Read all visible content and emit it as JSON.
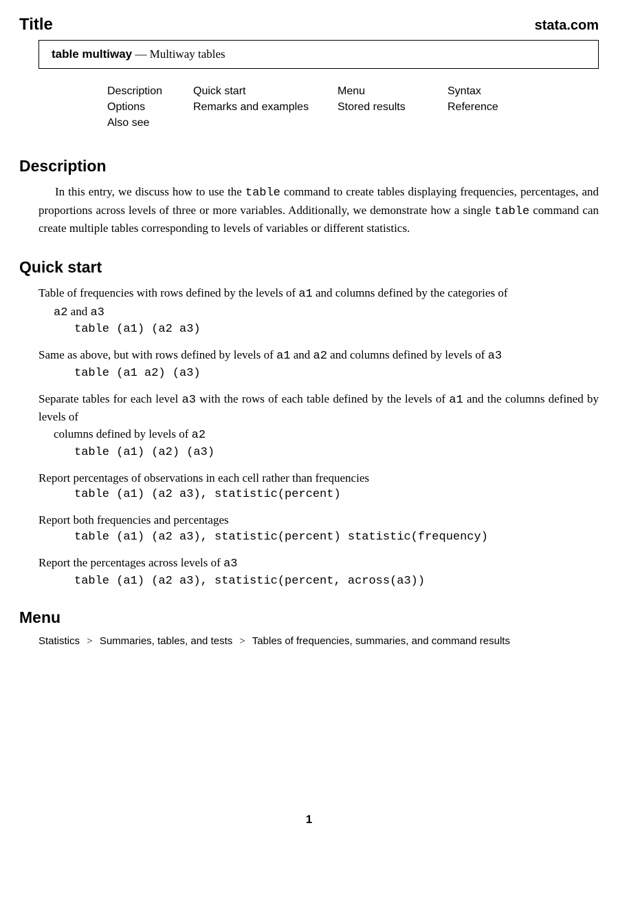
{
  "header": {
    "title_label": "Title",
    "brand": "stata.com"
  },
  "title_box": {
    "command": "table multiway",
    "separator": " — ",
    "subtitle": "Multiway tables"
  },
  "nav": {
    "r1c1": "Description",
    "r1c2": "Quick start",
    "r1c3": "Menu",
    "r1c4": "Syntax",
    "r2c1": "Options",
    "r2c2": "Remarks and examples",
    "r2c3": "Stored results",
    "r2c4": "Reference",
    "r3c1": "Also see"
  },
  "description": {
    "heading": "Description",
    "p1a": "In this entry, we discuss how to use the ",
    "p1cmd1": "table",
    "p1b": " command to create tables displaying frequencies, percentages, and proportions across levels of three or more variables. Additionally, we demonstrate how a single ",
    "p1cmd2": "table",
    "p1c": " command can create multiple tables corresponding to levels of variables or different statistics."
  },
  "quickstart": {
    "heading": "Quick start",
    "items": [
      {
        "d1": "Table of frequencies with rows defined by the levels of ",
        "v1": "a1",
        "d2": " and columns defined by the categories of ",
        "v2": "a2",
        "d3": " and ",
        "v3": "a3",
        "code": "table (a1) (a2 a3)"
      },
      {
        "d1": "Same as above, but with rows defined by levels of ",
        "v1": "a1",
        "d2": " and ",
        "v2": "a2",
        "d3": " and columns defined by levels of ",
        "v3": "a3",
        "code": "table (a1 a2) (a3)"
      },
      {
        "d1": "Separate tables for each level ",
        "v1": "a3",
        "d2": " with the rows of each table defined by the levels of ",
        "v2": "a1",
        "d3": " and the columns defined by levels of ",
        "v3": "a2",
        "code": "table (a1) (a2) (a3)"
      },
      {
        "d1": "Report percentages of observations in each cell rather than frequencies",
        "code": "table (a1) (a2 a3), statistic(percent)"
      },
      {
        "d1": "Report both frequencies and percentages",
        "code": "table (a1) (a2 a3), statistic(percent) statistic(frequency)"
      },
      {
        "d1": "Report the percentages across levels of ",
        "v1": "a3",
        "code": "table (a1) (a2 a3), statistic(percent, across(a3))"
      }
    ]
  },
  "menu": {
    "heading": "Menu",
    "p1": "Statistics",
    "sep": ">",
    "p2": "Summaries, tables, and tests",
    "p3": "Tables of frequencies, summaries, and command results"
  },
  "page_number": "1"
}
